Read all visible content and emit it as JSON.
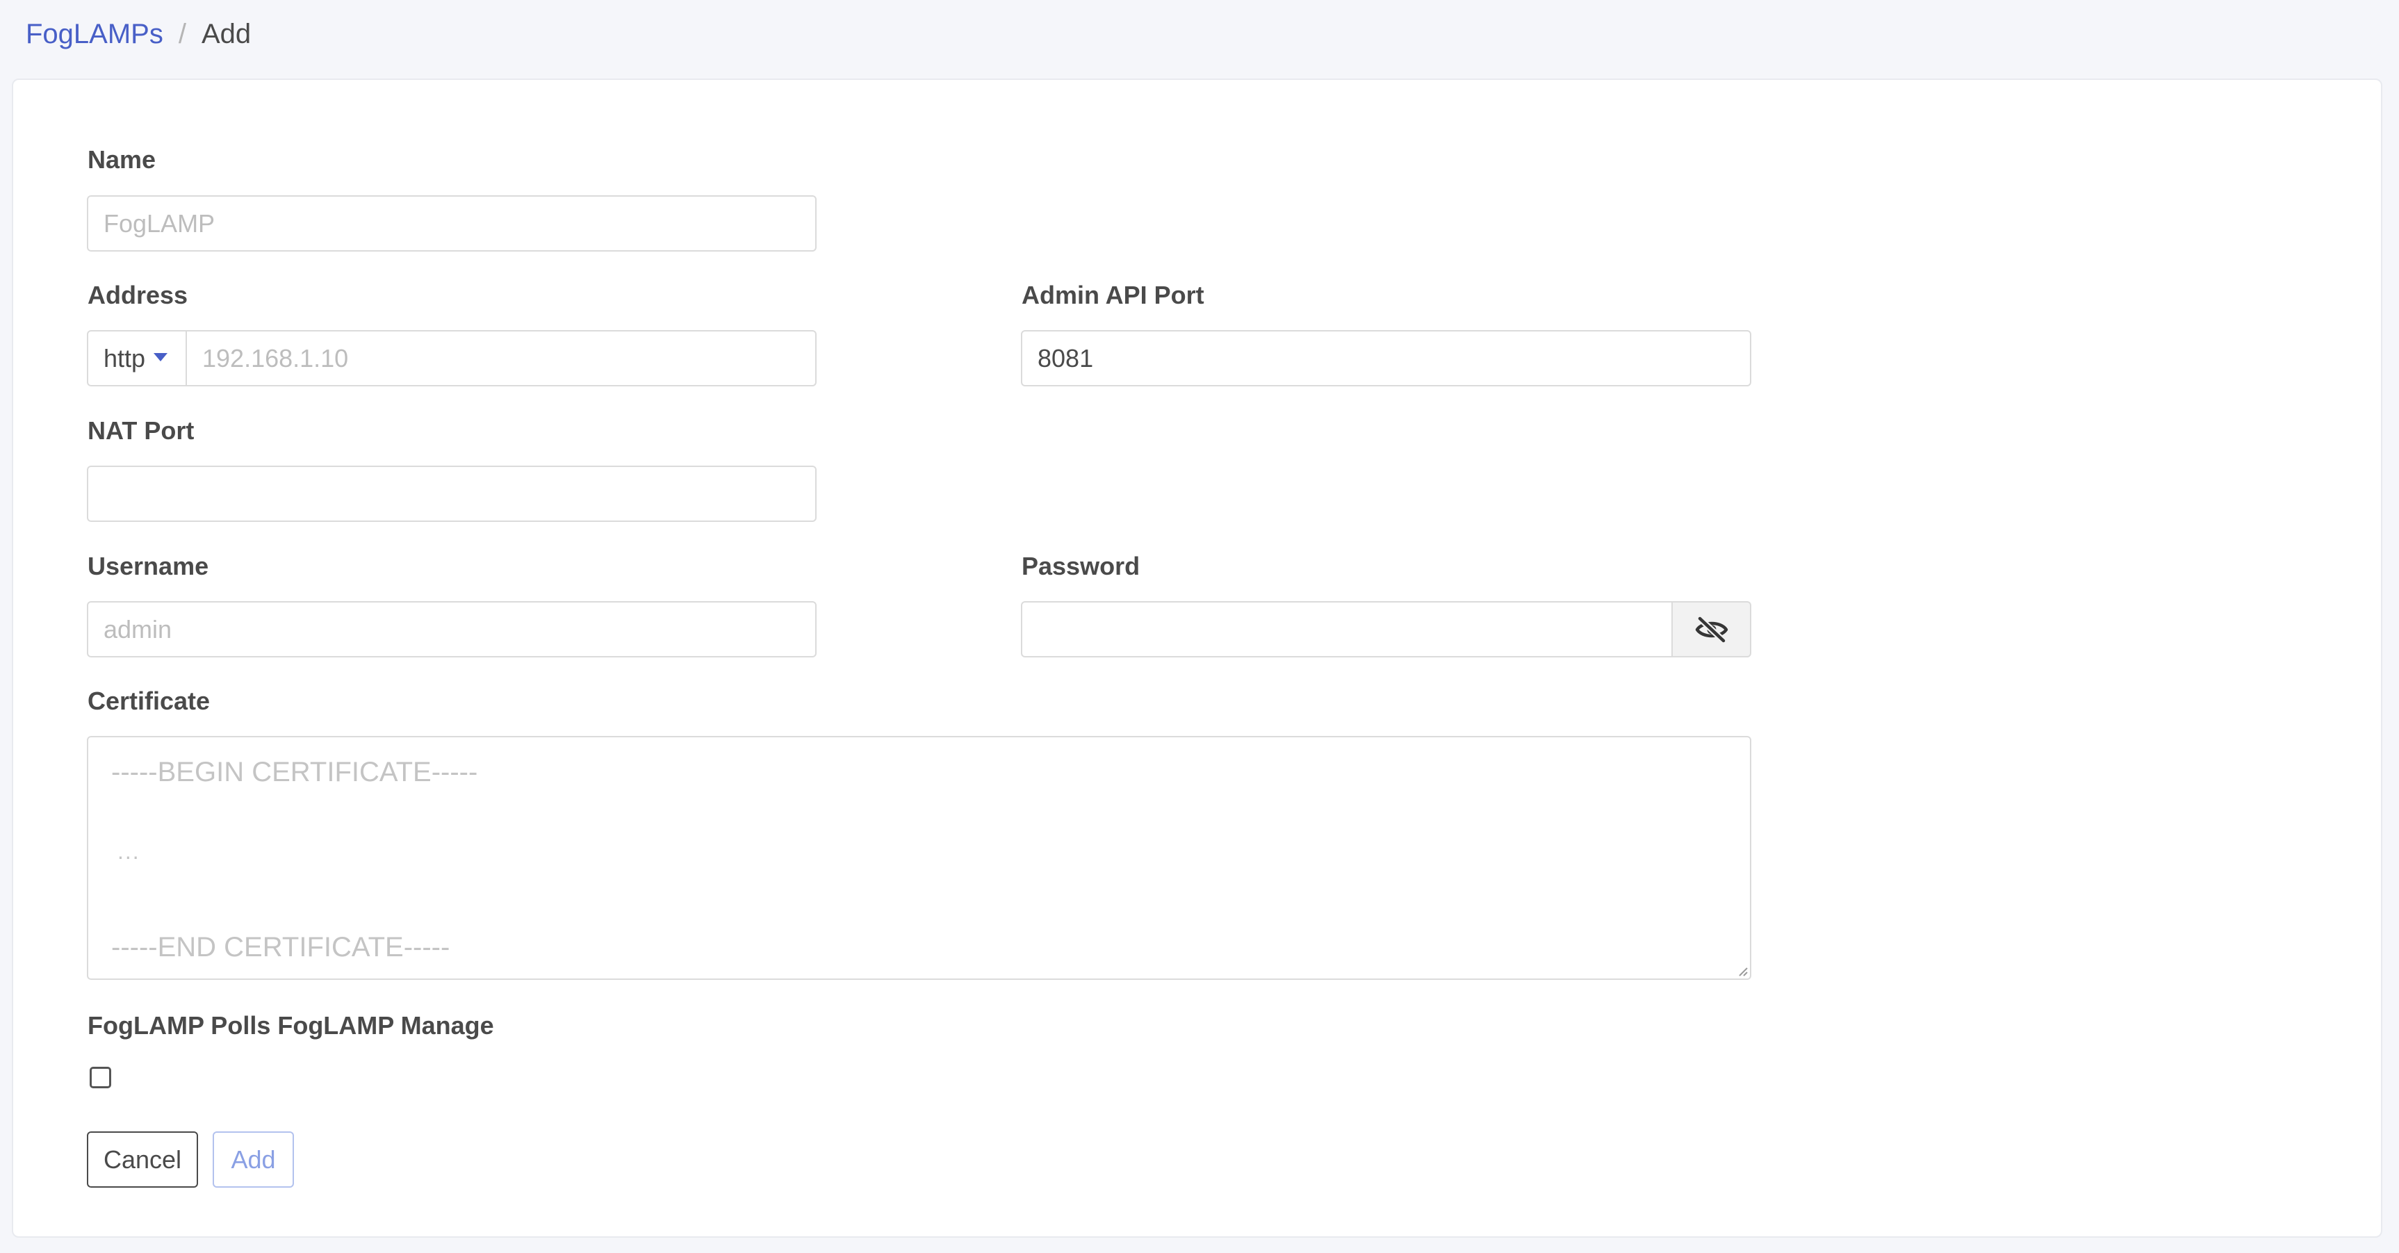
{
  "breadcrumb": {
    "parent": "FogLAMPs",
    "separator": "/",
    "current": "Add"
  },
  "form": {
    "name": {
      "label": "Name",
      "placeholder": "FogLAMP",
      "value": ""
    },
    "address": {
      "label": "Address",
      "protocol": "http",
      "placeholder": "192.168.1.10",
      "value": ""
    },
    "admin_api_port": {
      "label": "Admin API Port",
      "value": "8081"
    },
    "nat_port": {
      "label": "NAT Port",
      "value": ""
    },
    "username": {
      "label": "Username",
      "placeholder": "admin",
      "value": ""
    },
    "password": {
      "label": "Password",
      "value": "",
      "toggle_icon": "eye-slash-icon"
    },
    "certificate": {
      "label": "Certificate",
      "placeholder_lines": [
        "-----BEGIN CERTIFICATE-----",
        "...",
        "-----END CERTIFICATE-----"
      ]
    },
    "polls_manage": {
      "label": "FogLAMP Polls FogLAMP Manage",
      "checked": false
    }
  },
  "actions": {
    "cancel_label": "Cancel",
    "add_label": "Add"
  },
  "colors": {
    "link": "#485fc7",
    "add_button_border": "#b3c2ee",
    "add_button_text": "#8aa0e4",
    "page_background": "#f5f6fa"
  }
}
